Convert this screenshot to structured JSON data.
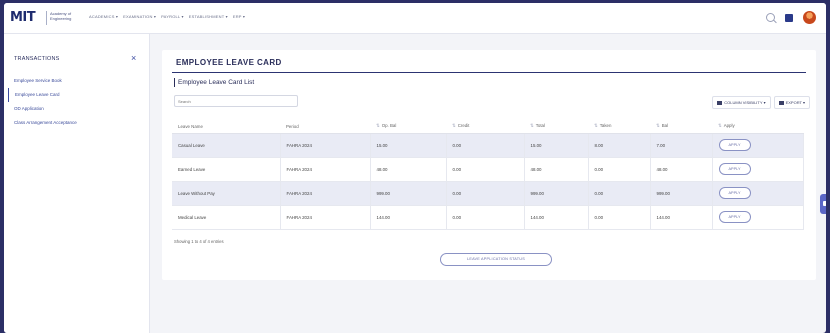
{
  "header": {
    "logo": "MIT",
    "logo_sub": "Academy of Engineering",
    "nav": [
      "ACADEMICS ▾",
      "EXAMINATION ▾",
      "PAYROLL ▾",
      "ESTABLISHMENT ▾",
      "ERP ▾"
    ]
  },
  "sidebar": {
    "title": "TRANSACTIONS",
    "close": "×",
    "items": [
      {
        "label": "Employee Service Book"
      },
      {
        "label": "Employee Leave Card"
      },
      {
        "label": "OD Application"
      },
      {
        "label": "Class Arrangement Acceptance"
      }
    ]
  },
  "card": {
    "title": "EMPLOYEE LEAVE CARD",
    "subtitle": "Employee Leave Card List",
    "search_placeholder": "Search",
    "column_visibility": "COLUMN VISIBILITY ▾",
    "export": "EXPORT ▾",
    "columns": [
      "Leave Name",
      "Period",
      "Op. Bal",
      "Credit",
      "Total",
      "Taken",
      "Bal",
      "Apply"
    ],
    "rows": [
      {
        "name": "Casual Leave",
        "period": "FAHRA 2024",
        "opbal": "15.00",
        "credit": "0.00",
        "total": "15.00",
        "taken": "8.00",
        "bal": "7.00",
        "apply": "APPLY"
      },
      {
        "name": "Earned Leave",
        "period": "FAHRA 2024",
        "opbal": "48.00",
        "credit": "0.00",
        "total": "48.00",
        "taken": "0.00",
        "bal": "48.00",
        "apply": "APPLY"
      },
      {
        "name": "Leave Without Pay",
        "period": "FAHRA 2024",
        "opbal": "999.00",
        "credit": "0.00",
        "total": "999.00",
        "taken": "0.00",
        "bal": "999.00",
        "apply": "APPLY"
      },
      {
        "name": "Medical Leave",
        "period": "FAHRA 2024",
        "opbal": "144.00",
        "credit": "0.00",
        "total": "144.00",
        "taken": "0.00",
        "bal": "144.00",
        "apply": "APPLY"
      }
    ],
    "showing": "Showing 1 to 4 of 4 entries",
    "status_button": "LEAVE APPLICATION STATUS"
  },
  "colors": {
    "brand": "#1e2b6e",
    "accent": "#3a4aa0",
    "row_stripe": "#e9ebf5"
  },
  "icons": [
    "search-icon",
    "apps-icon",
    "user-avatar",
    "close-icon",
    "column-visibility-icon",
    "export-icon",
    "side-tab-icon"
  ]
}
